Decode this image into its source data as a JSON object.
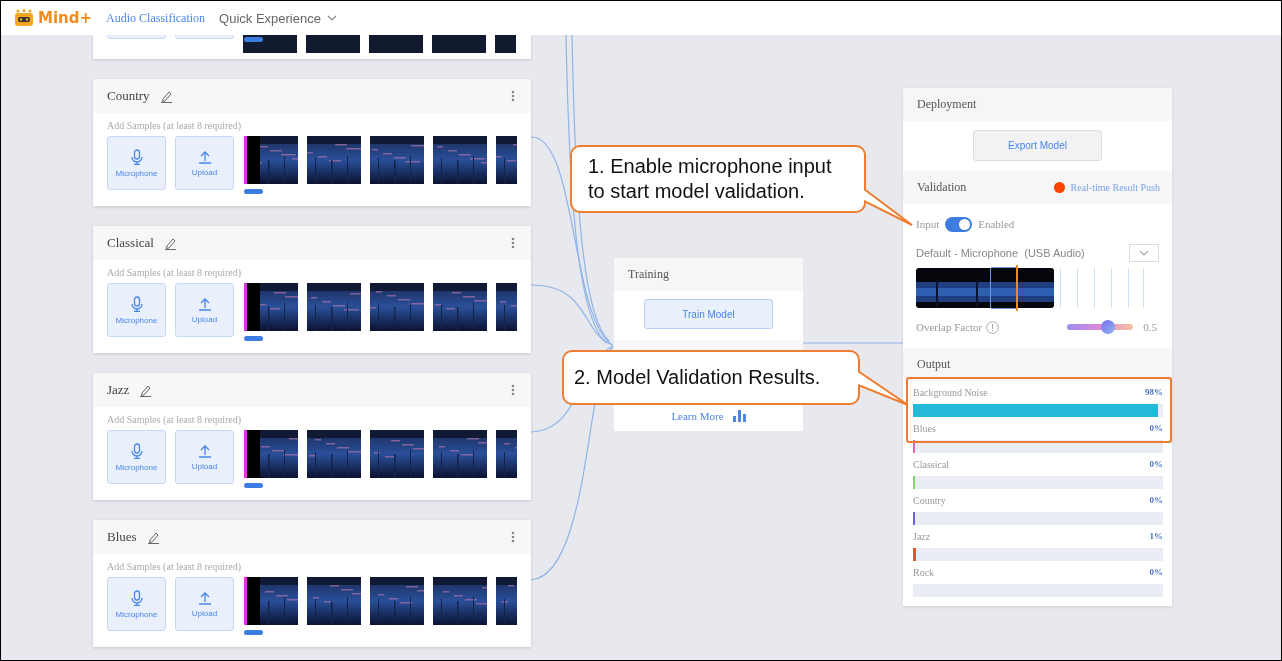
{
  "header": {
    "logo": "Mind+",
    "nav": [
      {
        "label": "Audio Classification",
        "selected": true,
        "kind": "link"
      },
      {
        "label": "Quick Experience",
        "selected": false,
        "kind": "dropdown"
      }
    ]
  },
  "cards": [
    {
      "kind": "partial"
    },
    {
      "kind": "class",
      "name": "Country",
      "hint": "Add Samples (at least 8 required)",
      "buttons": [
        "Microphone",
        "Upload"
      ]
    },
    {
      "kind": "class",
      "name": "Classical",
      "hint": "Add Samples (at least 8 required)",
      "buttons": [
        "Microphone",
        "Upload"
      ]
    },
    {
      "kind": "class",
      "name": "Jazz",
      "hint": "Add Samples (at least 8 required)",
      "buttons": [
        "Microphone",
        "Upload"
      ]
    },
    {
      "kind": "class",
      "name": "Blues",
      "hint": "Add Samples (at least 8 required)",
      "buttons": [
        "Microphone",
        "Upload"
      ]
    }
  ],
  "training": {
    "title": "Training",
    "button": "Train Model",
    "link": "Learn More"
  },
  "deployment": {
    "title": "Deployment",
    "button": "Export Model"
  },
  "validation": {
    "title": "Validation",
    "push": "Real-time Result Push",
    "input_label": "Input",
    "input_on": true,
    "input_state": "Enabled",
    "device": "Default - Microphone  (USB Audio)",
    "overlap_label": "Overlap Factor",
    "overlap": {
      "level": 0.62,
      "reading": "0.5"
    }
  },
  "output": {
    "title": "Output",
    "rows": [
      {
        "name": "Background Noise",
        "reading": "98%",
        "level": 0.98,
        "color": "#26b8d8"
      },
      {
        "name": "Blues",
        "reading": "0%",
        "level": 0,
        "color": "#e066c0"
      },
      {
        "name": "Classical",
        "reading": "0%",
        "level": 0,
        "color": "#7ed66a"
      },
      {
        "name": "Country",
        "reading": "0%",
        "level": 0,
        "color": "#6b5ce0"
      },
      {
        "name": "Jazz",
        "reading": "1%",
        "level": 0.01,
        "color": "#e05a20"
      },
      {
        "name": "Rock",
        "reading": "0%",
        "level": 0
      }
    ]
  },
  "callouts": [
    {
      "text": "1. Enable microphone input to start model validation."
    },
    {
      "text": "2. Model Validation Results."
    }
  ]
}
